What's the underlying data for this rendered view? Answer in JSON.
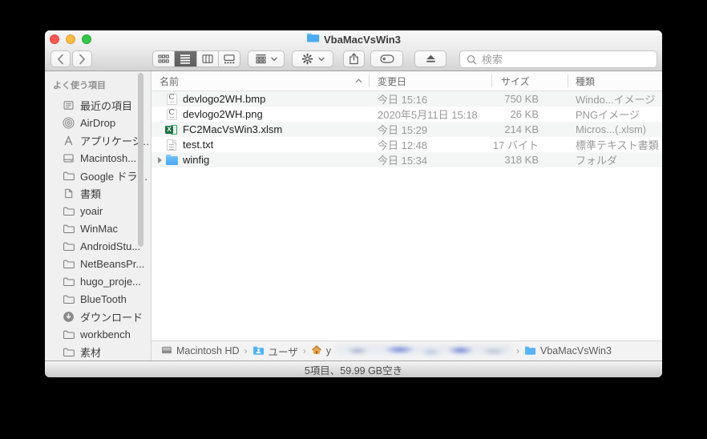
{
  "window": {
    "title": "VbaMacVsWin3"
  },
  "toolbar": {
    "search_placeholder": "検索",
    "selected_view": "list"
  },
  "sidebar": {
    "section_title": "よく使う項目",
    "items": [
      {
        "label": "最近の項目",
        "icon": "recents"
      },
      {
        "label": "AirDrop",
        "icon": "airdrop"
      },
      {
        "label": "アプリケーシ…",
        "icon": "applications"
      },
      {
        "label": "Macintosh...",
        "icon": "drive"
      },
      {
        "label": "Google ドラ…",
        "icon": "folder"
      },
      {
        "label": "書類",
        "icon": "documents"
      },
      {
        "label": "yoair",
        "icon": "folder"
      },
      {
        "label": "WinMac",
        "icon": "folder"
      },
      {
        "label": "AndroidStu...",
        "icon": "folder"
      },
      {
        "label": "NetBeansPr...",
        "icon": "folder"
      },
      {
        "label": "hugo_proje...",
        "icon": "folder"
      },
      {
        "label": "BlueTooth",
        "icon": "folder"
      },
      {
        "label": "ダウンロード",
        "icon": "download"
      },
      {
        "label": "workbench",
        "icon": "folder"
      },
      {
        "label": "素材",
        "icon": "folder"
      },
      {
        "label": "",
        "icon": "folder",
        "partial": true
      }
    ]
  },
  "list": {
    "columns": [
      {
        "label": "名前"
      },
      {
        "label": "変更日"
      },
      {
        "label": "サイズ"
      },
      {
        "label": "種類"
      }
    ],
    "sort_column": "名前",
    "rows": [
      {
        "name": "devlogo2WH.bmp",
        "date": "今日 15:16",
        "size": "750 KB",
        "kind": "Windo...イメージ",
        "icon": "image"
      },
      {
        "name": "devlogo2WH.png",
        "date": "2020年5月11日 15:18",
        "size": "26 KB",
        "kind": "PNGイメージ",
        "icon": "image"
      },
      {
        "name": "FC2MacVsWin3.xlsm",
        "date": "今日 15:29",
        "size": "214 KB",
        "kind": "Micros...(.xlsm)",
        "icon": "excel"
      },
      {
        "name": "test.txt",
        "date": "今日 12:48",
        "size": "17 バイト",
        "kind": "標準テキスト書類",
        "icon": "text"
      },
      {
        "name": "winfig",
        "date": "今日 15:34",
        "size": "318 KB",
        "kind": "フォルダ",
        "icon": "folder",
        "disclosure": true
      }
    ]
  },
  "pathbar": {
    "items": [
      {
        "label": "Macintosh HD",
        "icon": "hd"
      },
      {
        "label": "ユーザ",
        "icon": "users"
      },
      {
        "label": "y",
        "icon": "home",
        "redacted": true
      },
      {
        "label": "VbaMacVsWin3",
        "icon": "bluefolder"
      }
    ]
  },
  "statusbar": {
    "text": "5項目、59.99 GB空き"
  }
}
